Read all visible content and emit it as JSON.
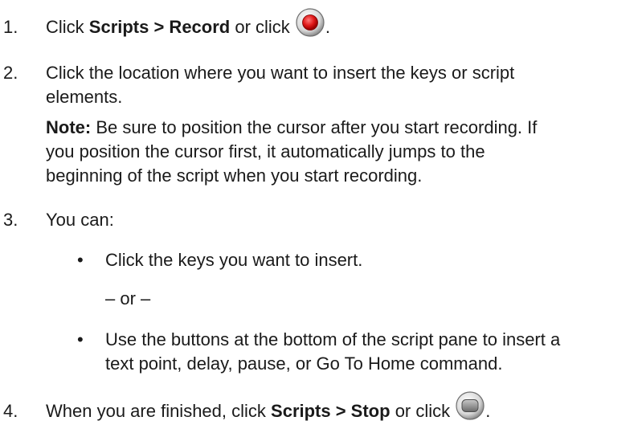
{
  "steps": [
    {
      "num": "1.",
      "pre": "Click ",
      "menu": "Scripts > Record",
      "post": " or click ",
      "icon": "record-icon",
      "end": "."
    },
    {
      "num": "2.",
      "line1": "Click the location where you want to insert the keys or script",
      "line2": "elements."
    },
    {
      "num": "3.",
      "text": "You can:"
    },
    {
      "num": "4.",
      "pre": "When you are finished, click ",
      "menu": "Scripts > Stop",
      "post": " or click ",
      "icon": "stop-icon",
      "end": "."
    }
  ],
  "note": {
    "label": "Note:",
    "line1": " Be sure to position the cursor after you start recording. If",
    "line2": "you position the cursor first, it automatically jumps to the",
    "line3": "beginning of the script when you start recording."
  },
  "options": [
    {
      "bullet": "•",
      "line1": "Click the keys you want to insert."
    },
    {
      "bullet": "•",
      "line1": "Use the buttons at the bottom of the script pane to insert a",
      "line2": "text point, delay, pause, or Go To Home command."
    }
  ],
  "separator": "– or –",
  "colors": {
    "record_red": "#e01818",
    "stop_gray": "#8a8a8a"
  }
}
